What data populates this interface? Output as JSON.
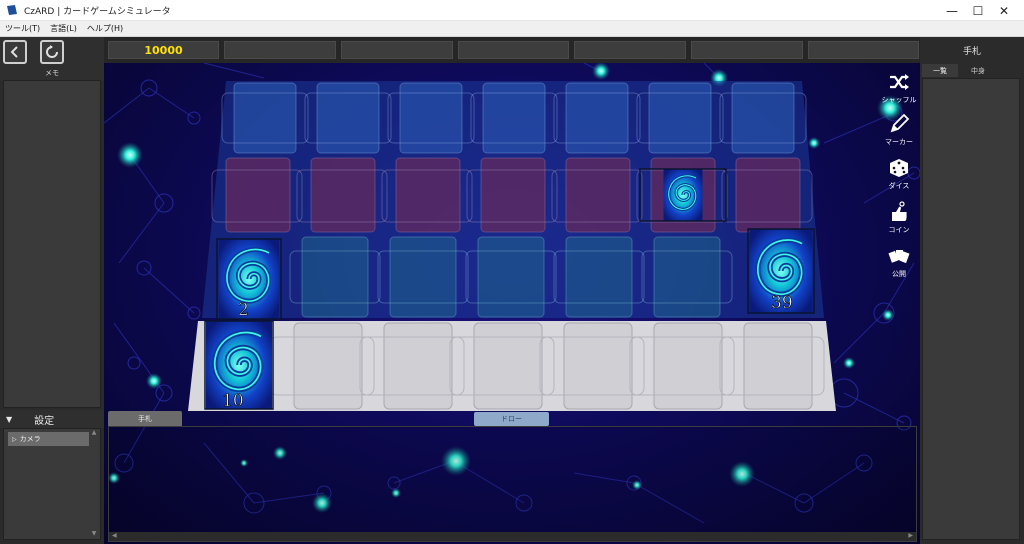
{
  "window": {
    "title": "CzARD | カードゲームシミュレータ",
    "minimize": "—",
    "maximize": "☐",
    "close": "✕"
  },
  "menu": [
    "ツール(T)",
    "言語(L)",
    "ヘルプ(H)"
  ],
  "left": {
    "memo_label": "メモ",
    "settings_label": "設定",
    "settings_toggle": "▼",
    "camera_label": "カメラ"
  },
  "scorebar": {
    "score": "10000",
    "boxes": [
      "",
      "",
      "",
      "",
      "",
      ""
    ]
  },
  "board": {
    "deck_count": "39",
    "left_stack_count": "2",
    "hand_stack_count": "10"
  },
  "tools": {
    "shuffle": "シャッフル",
    "marker": "マーカー",
    "dice": "ダイス",
    "coin": "コイン",
    "reveal": "公開"
  },
  "hand": {
    "tab_label": "手札",
    "draw_label": "ドロー"
  },
  "right": {
    "header": "手札",
    "tab_list": "一覧",
    "tab_contents": "中身"
  },
  "colors": {
    "score": "#ffe100",
    "background": "#0e0a5a",
    "card_swirl": "#00d5c0"
  }
}
